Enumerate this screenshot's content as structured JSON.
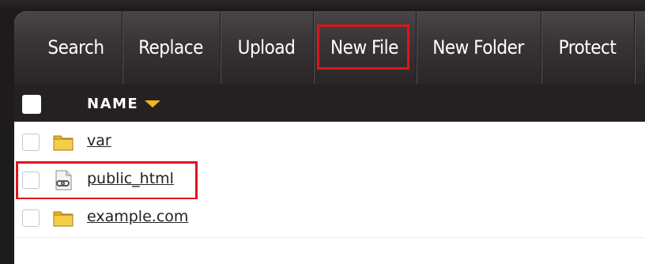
{
  "toolbar": {
    "buttons": [
      {
        "label": "Search"
      },
      {
        "label": "Replace"
      },
      {
        "label": "Upload"
      },
      {
        "label": "New File"
      },
      {
        "label": "New Folder"
      },
      {
        "label": "Protect"
      }
    ]
  },
  "table": {
    "header": {
      "name_label": "NAME",
      "sort_icon": "sort-descending-icon"
    },
    "rows": [
      {
        "name": "var",
        "icon": "folder-icon"
      },
      {
        "name": "public_html",
        "icon": "symlink-file-icon"
      },
      {
        "name": "example.com",
        "icon": "folder-icon"
      }
    ]
  },
  "colors": {
    "highlight": "#e0141c",
    "sort_arrow": "#f2b619",
    "toolbar_top": "#4a4547",
    "header_bg": "#252122"
  }
}
